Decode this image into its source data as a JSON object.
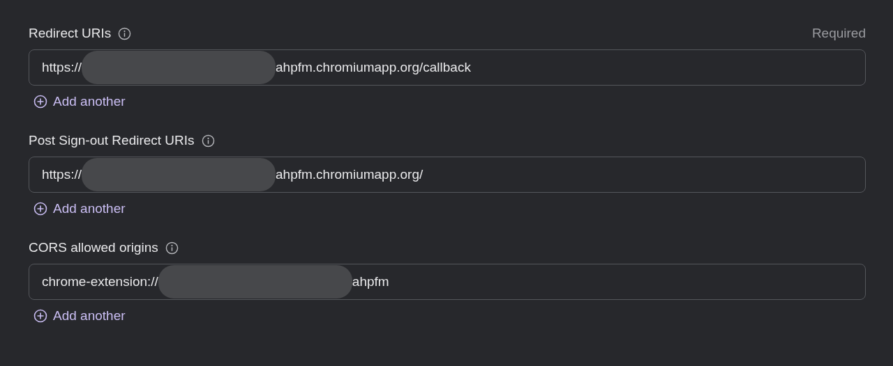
{
  "sections": [
    {
      "label": "Redirect URIs",
      "required_note": "Required",
      "fields": [
        {
          "value_start": "https://",
          "redacted": true,
          "value_end": "ahpfm.chromiumapp.org/callback"
        }
      ],
      "add_link": "Add another"
    },
    {
      "label": "Post Sign-out Redirect URIs",
      "fields": [
        {
          "value_start": "https://",
          "redacted": true,
          "value_end": "ahpfm.chromiumapp.org/"
        }
      ],
      "add_link": "Add another"
    },
    {
      "label": "CORS allowed origins",
      "fields": [
        {
          "value_start": "chrome-extension://",
          "redacted": true,
          "value_end": "ahpfm"
        }
      ],
      "add_link": "Add another"
    }
  ]
}
